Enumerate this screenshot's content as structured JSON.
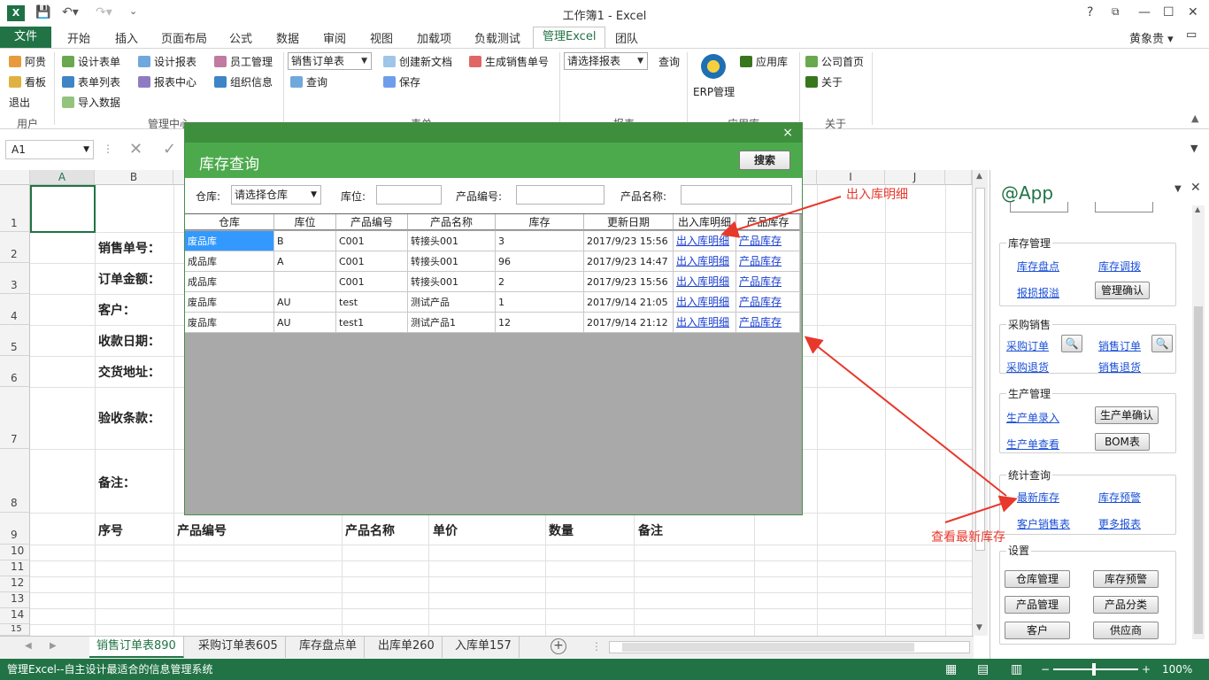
{
  "window": {
    "title": "工作簿1 - Excel",
    "user": "黄象贵",
    "help": "?"
  },
  "ribbon_tabs": [
    "文件",
    "开始",
    "插入",
    "页面布局",
    "公式",
    "数据",
    "审阅",
    "视图",
    "加载项",
    "负载测试",
    "管理Excel",
    "团队"
  ],
  "ribbon": {
    "user_group": {
      "label": "用户",
      "items": [
        "阿贵",
        "看板",
        "退出"
      ]
    },
    "mgmt_group": {
      "label": "管理中心",
      "items": [
        "设计表单",
        "表单列表",
        "导入数据",
        "设计报表",
        "报表中心",
        "员工管理",
        "组织信息"
      ]
    },
    "form_group": {
      "label": "表单",
      "combo": "销售订单表",
      "query": "查询",
      "items": [
        "创建新文档",
        "保存",
        "生成销售单号"
      ]
    },
    "report_group": {
      "label": "报表",
      "combo": "请选择报表",
      "query": "查询"
    },
    "app_group": {
      "label": "应用库",
      "items": [
        "ERP管理",
        "应用库"
      ]
    },
    "about_group": {
      "label": "关于",
      "items": [
        "公司首页",
        "关于"
      ]
    }
  },
  "formula_bar": {
    "name_box": "A1"
  },
  "grid": {
    "columns": [
      "A",
      "B",
      "I",
      "J"
    ],
    "rows": [
      "1",
      "2",
      "3",
      "4",
      "5",
      "6",
      "7",
      "8",
      "9",
      "10",
      "11",
      "12",
      "13",
      "14",
      "15"
    ],
    "labels": [
      "销售单号：",
      "订单金额：",
      "客户：",
      "收款日期：",
      "交货地址：",
      "验收条款：",
      "备注："
    ],
    "header_row": [
      "序号",
      "产品编号",
      "产品名称",
      "单价",
      "数量",
      "备注"
    ]
  },
  "sheet_tabs": [
    "销售订单表890",
    "采购订单表605",
    "库存盘点单",
    "出库单260",
    "入库单157"
  ],
  "status": {
    "text": "管理Excel--自主设计最适合的信息管理系统",
    "zoom": "100%"
  },
  "dialog": {
    "title": "库存查询",
    "close": "×",
    "search_button": "搜索",
    "filters": {
      "warehouse_label": "仓库:",
      "warehouse_value": "请选择仓库",
      "location_label": "库位:",
      "code_label": "产品编号:",
      "name_label": "产品名称:"
    },
    "columns": [
      "仓库",
      "库位",
      "产品编号",
      "产品名称",
      "库存",
      "更新日期",
      "出入库明细",
      "产品库存"
    ],
    "rows": [
      [
        "废品库",
        "B",
        "C001",
        "转接头001",
        "3",
        "2017/9/23 15:56",
        "出入库明细",
        "产品库存"
      ],
      [
        "成品库",
        "A",
        "C001",
        "转接头001",
        "96",
        "2017/9/23 14:47",
        "出入库明细",
        "产品库存"
      ],
      [
        "成品库",
        "",
        "C001",
        "转接头001",
        "2",
        "2017/9/23 15:56",
        "出入库明细",
        "产品库存"
      ],
      [
        "废品库",
        "AU",
        "test",
        "测试产品",
        "1",
        "2017/9/14 21:05",
        "出入库明细",
        "产品库存"
      ],
      [
        "废品库",
        "AU",
        "test1",
        "测试产品1",
        "12",
        "2017/9/14 21:12",
        "出入库明细",
        "产品库存"
      ]
    ]
  },
  "pane": {
    "title": "@App",
    "sections": {
      "inventory": {
        "title": "库存管理",
        "links": [
          "库存盘点",
          "库存调拨",
          "报损报溢"
        ],
        "button": "管理确认"
      },
      "purchase_sales": {
        "title": "采购销售",
        "links": [
          "采购订单",
          "销售订单",
          "采购退货",
          "销售退货"
        ]
      },
      "production": {
        "title": "生产管理",
        "links": [
          "生产单录入",
          "生产单查看"
        ],
        "buttons": [
          "生产单确认",
          "BOM表"
        ]
      },
      "stats": {
        "title": "统计查询",
        "links": [
          "最新库存",
          "库存预警",
          "客户销售表",
          "更多报表"
        ]
      },
      "settings": {
        "title": "设置",
        "buttons": [
          "仓库管理",
          "库存预警",
          "产品管理",
          "产品分类",
          "客户",
          "供应商"
        ]
      }
    }
  },
  "annotations": {
    "detail": "出入库明细",
    "latest": "查看最新库存"
  },
  "colors": {
    "excel_green": "#217346",
    "dialog_green": "#4caa4c",
    "annotation_red": "#e8382c"
  }
}
